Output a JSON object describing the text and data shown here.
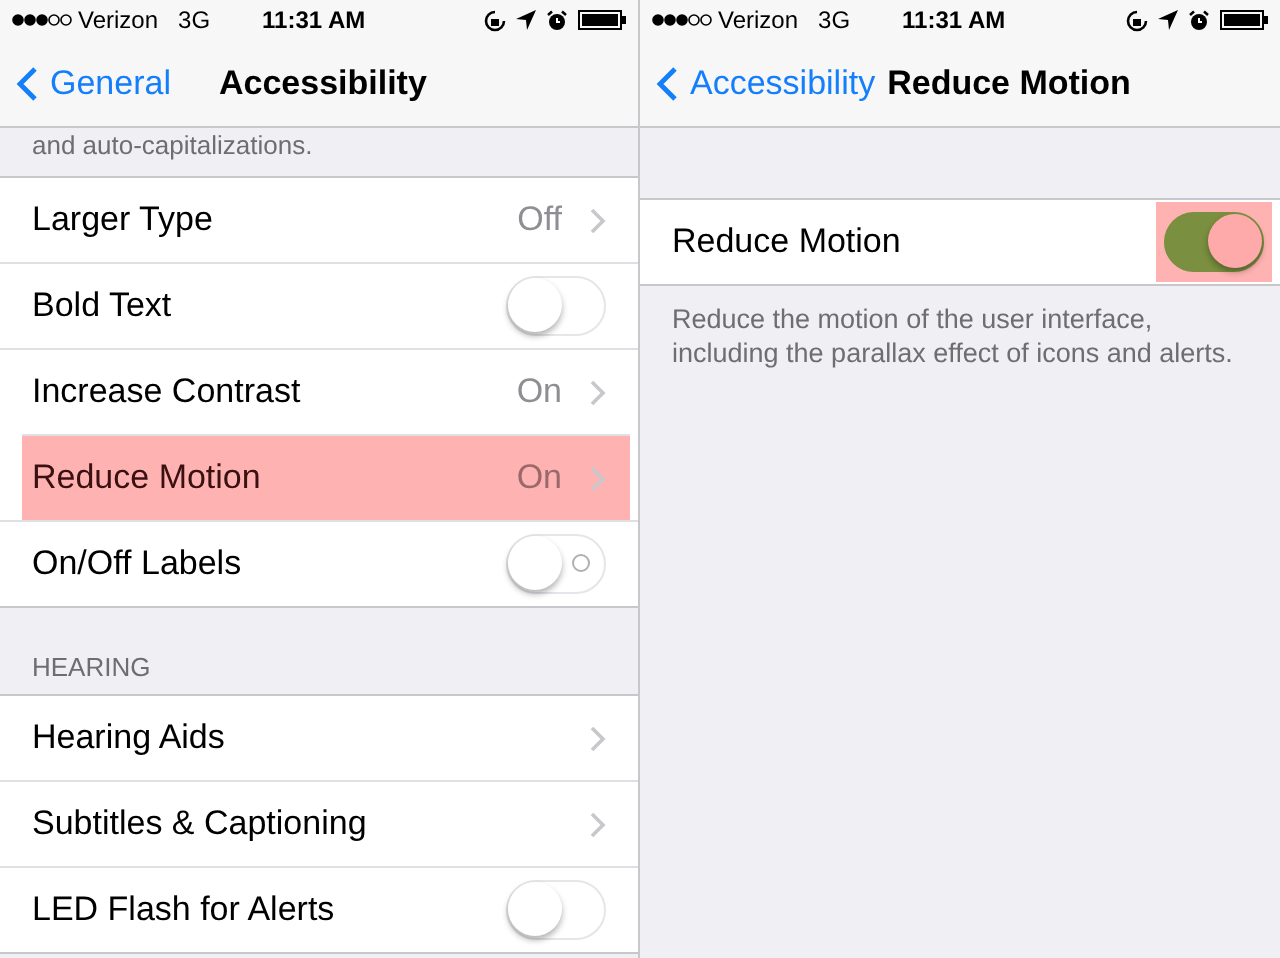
{
  "screens": [
    {
      "status_bar": {
        "carrier": "Verizon",
        "network": "3G",
        "time": "11:31 AM"
      },
      "nav": {
        "back": "General",
        "title": "Accessibility"
      },
      "top_note": "and auto-capitalizations.",
      "sections": [
        {
          "rows": [
            {
              "label": "Larger Type",
              "kind": "detail",
              "value": "Off",
              "highlighted": false
            },
            {
              "label": "Bold Text",
              "kind": "switch",
              "on": false,
              "highlighted": false
            },
            {
              "label": "Increase Contrast",
              "kind": "detail",
              "value": "On",
              "highlighted": false
            },
            {
              "label": "Reduce Motion",
              "kind": "detail",
              "value": "On",
              "highlighted": true
            },
            {
              "label": "On/Off Labels",
              "kind": "switch",
              "on": false,
              "on_off_label": true,
              "highlighted": false
            }
          ]
        },
        {
          "header": "HEARING",
          "rows": [
            {
              "label": "Hearing Aids",
              "kind": "detail",
              "highlighted": false
            },
            {
              "label": "Subtitles & Captioning",
              "kind": "detail",
              "highlighted": false
            },
            {
              "label": "LED Flash for Alerts",
              "kind": "switch",
              "on": false,
              "highlighted": false
            }
          ]
        }
      ]
    },
    {
      "status_bar": {
        "carrier": "Verizon",
        "network": "3G",
        "time": "11:31 AM"
      },
      "nav": {
        "back": "Accessibility",
        "title": "Reduce Motion"
      },
      "sections": [
        {
          "rows": [
            {
              "label": "Reduce Motion",
              "kind": "switch",
              "on": true,
              "highlighted": true
            }
          ],
          "footer": "Reduce the motion of the user interface, including the parallax effect of icons and alerts."
        }
      ]
    }
  ]
}
